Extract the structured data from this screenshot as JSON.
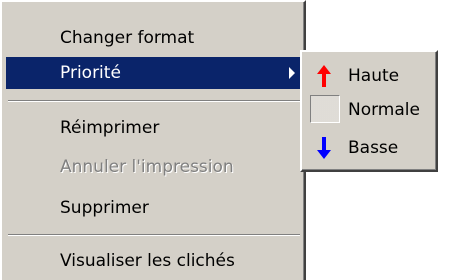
{
  "menu": {
    "items": [
      {
        "label": "Changer format"
      },
      {
        "label": "Priorité"
      },
      {
        "label": "Réimprimer"
      },
      {
        "label": "Annuler l'impression"
      },
      {
        "label": "Supprimer"
      },
      {
        "label": "Visualiser les clichés"
      }
    ],
    "selected_index": 1
  },
  "submenu": {
    "items": [
      {
        "label": "Haute",
        "icon": "arrow-up-icon",
        "color": "#ff0000"
      },
      {
        "label": "Normale",
        "icon": "checked-box-icon"
      },
      {
        "label": "Basse",
        "icon": "arrow-down-icon",
        "color": "#0000ff"
      }
    ]
  },
  "colors": {
    "menu_bg": "#d4d0c8",
    "highlight": "#0a246a",
    "disabled_text": "#808080"
  }
}
